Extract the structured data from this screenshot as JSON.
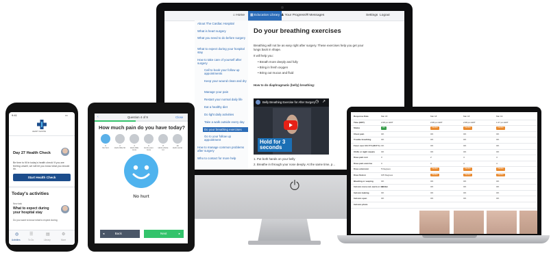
{
  "desktop": {
    "nav": [
      {
        "label": "⌂ Home",
        "active": false
      },
      {
        "label": "▦ Education Library",
        "active": true
      },
      {
        "label": "♟ Your Progress",
        "active": false
      },
      {
        "label": "✉ Messages",
        "active": false
      }
    ],
    "nav_right": [
      "Settings",
      "Logout"
    ],
    "sidebar": [
      {
        "label": "About The Cardiac Hospital",
        "sub": false
      },
      {
        "label": "What is heart surgery",
        "sub": false
      },
      {
        "label": "What you need to do before surgery",
        "sub": false
      },
      {
        "label": "What to expect during your hospital stay",
        "sub": false
      },
      {
        "label": "How to take care of yourself after surgery",
        "sub": false
      },
      {
        "label": "Call to book your follow up appointments",
        "sub": true
      },
      {
        "label": "Keep your wound clean and dry",
        "sub": true
      },
      {
        "label": "Manage your pain",
        "sub": true
      },
      {
        "label": "Restart your normal daily life",
        "sub": true
      },
      {
        "label": "Eat a healthy diet",
        "sub": true
      },
      {
        "label": "Do light daily activities",
        "sub": true
      },
      {
        "label": "Take a walk outside every day",
        "sub": true
      },
      {
        "label": "Do your breathing exercises",
        "sub": true,
        "active": true
      },
      {
        "label": "Go to your follow up appointment",
        "sub": true
      },
      {
        "label": "How to manage common problems after surgery",
        "sub": false
      },
      {
        "label": "Who to contact for more help",
        "sub": false
      }
    ],
    "title": "Do your breathing exercises",
    "intro": "Breathing will not be as easy right after surgery. These exercises help you get your lungs back in shape.",
    "help_heading": "It will help you:",
    "bullets": [
      "Breath more deeply and fully",
      "Bring in fresh oxygen",
      "Bring out mucus and fluid"
    ],
    "how_to_heading": "How to do diaphragmatic (belly) breathing:",
    "video_title": "Belly Breathing Exercise for After Surgery",
    "video_overlay": "Hold for 3 seconds",
    "steps": [
      "1. Put both hands on your belly",
      "2. Breathe in through your nose deeply. At the same time, p..."
    ]
  },
  "phone": {
    "status_time": "9:41",
    "hospital_label": "HEART CENTRE",
    "card_title": "Day 27 Health Check",
    "card_body": "Be time to fill in today's health check! If you are feeling unwell, we will let you know what you should do.",
    "card_button": "Start Health Check",
    "section_title": "Today's activities",
    "activity_tag": "New task",
    "activity_title": "What to expect during your hospital stay",
    "activity_body": "Do you want to know what to expect during",
    "tabs": [
      "Activities",
      "To Do",
      "Library",
      "More"
    ]
  },
  "tablet": {
    "progress": "Question 4 of 9",
    "close": "Close",
    "question": "How much pain do you have today?",
    "scale": [
      "0",
      "2",
      "4",
      "6",
      "8",
      "10"
    ],
    "scale_labels": [
      "No hurt",
      "Hurts little bit",
      "Hurts little more",
      "Hurts even more",
      "Hurts whole lot",
      "Hurts worst"
    ],
    "selected_label": "No hurt",
    "back": "Back",
    "next": "Next",
    "colors": {
      "face": "#4fb3ee",
      "next": "#33c36b",
      "back": "#4a5668"
    }
  },
  "laptop": {
    "rows": [
      {
        "label": "Response Date",
        "vals": [
          "Mar 18",
          "Mar 18",
          "Mar 18",
          "Mar 19"
        ]
      },
      {
        "label": "Time (EDT)",
        "vals": [
          "2:08 pm EDT",
          "2:08 pm EDT",
          "2:08 pm EDT",
          "1:27 pm EDT"
        ]
      },
      {
        "label": "Status",
        "vals": [
          "OK",
          "Caution",
          "Caution",
          "Caution"
        ]
      },
      {
        "label": "Chest pain",
        "vals": [
          "OK",
          "OK",
          "OK",
          "OK"
        ]
      },
      {
        "label": "Trouble breathing",
        "vals": [
          "OK",
          "OK",
          "OK",
          "OK"
        ]
      },
      {
        "label": "Fever over 101.5°F (38.5°C)",
        "vals": [
          "OK",
          "OK",
          "OK",
          "OK"
        ]
      },
      {
        "label": "Chills or night sweats",
        "vals": [
          "OK",
          "OK",
          "OK",
          "OK"
        ]
      },
      {
        "label": "Knee pain rest",
        "vals": [
          "3",
          "2",
          "4",
          "4"
        ]
      },
      {
        "label": "Knee pain exercise",
        "vals": [
          "3",
          "3",
          "4",
          "4"
        ]
      },
      {
        "label": "Knee extension",
        "vals": [
          "5 Degrees",
          "Caution",
          "Caution",
          "Caution"
        ]
      },
      {
        "label": "Knee flexion",
        "vals": [
          "105 Degrees",
          "Caution",
          "Caution",
          "Caution"
        ]
      },
      {
        "label": "Bleeding or seeping",
        "vals": [
          "OK",
          "OK",
          "OK",
          "OK"
        ]
      },
      {
        "label": "Incision more red, warm or swollen",
        "vals": [
          "OK",
          "OK",
          "OK",
          "OK"
        ]
      },
      {
        "label": "Incision leaking",
        "vals": [
          "OK",
          "OK",
          "OK",
          "OK"
        ]
      },
      {
        "label": "Incision open",
        "vals": [
          "OK",
          "OK",
          "OK",
          "OK"
        ]
      },
      {
        "label": "Incision photo",
        "vals": [
          "",
          "",
          "",
          ""
        ]
      }
    ],
    "colors": {
      "ok": "#3a9d4c",
      "caution": "#e98a2f"
    }
  }
}
